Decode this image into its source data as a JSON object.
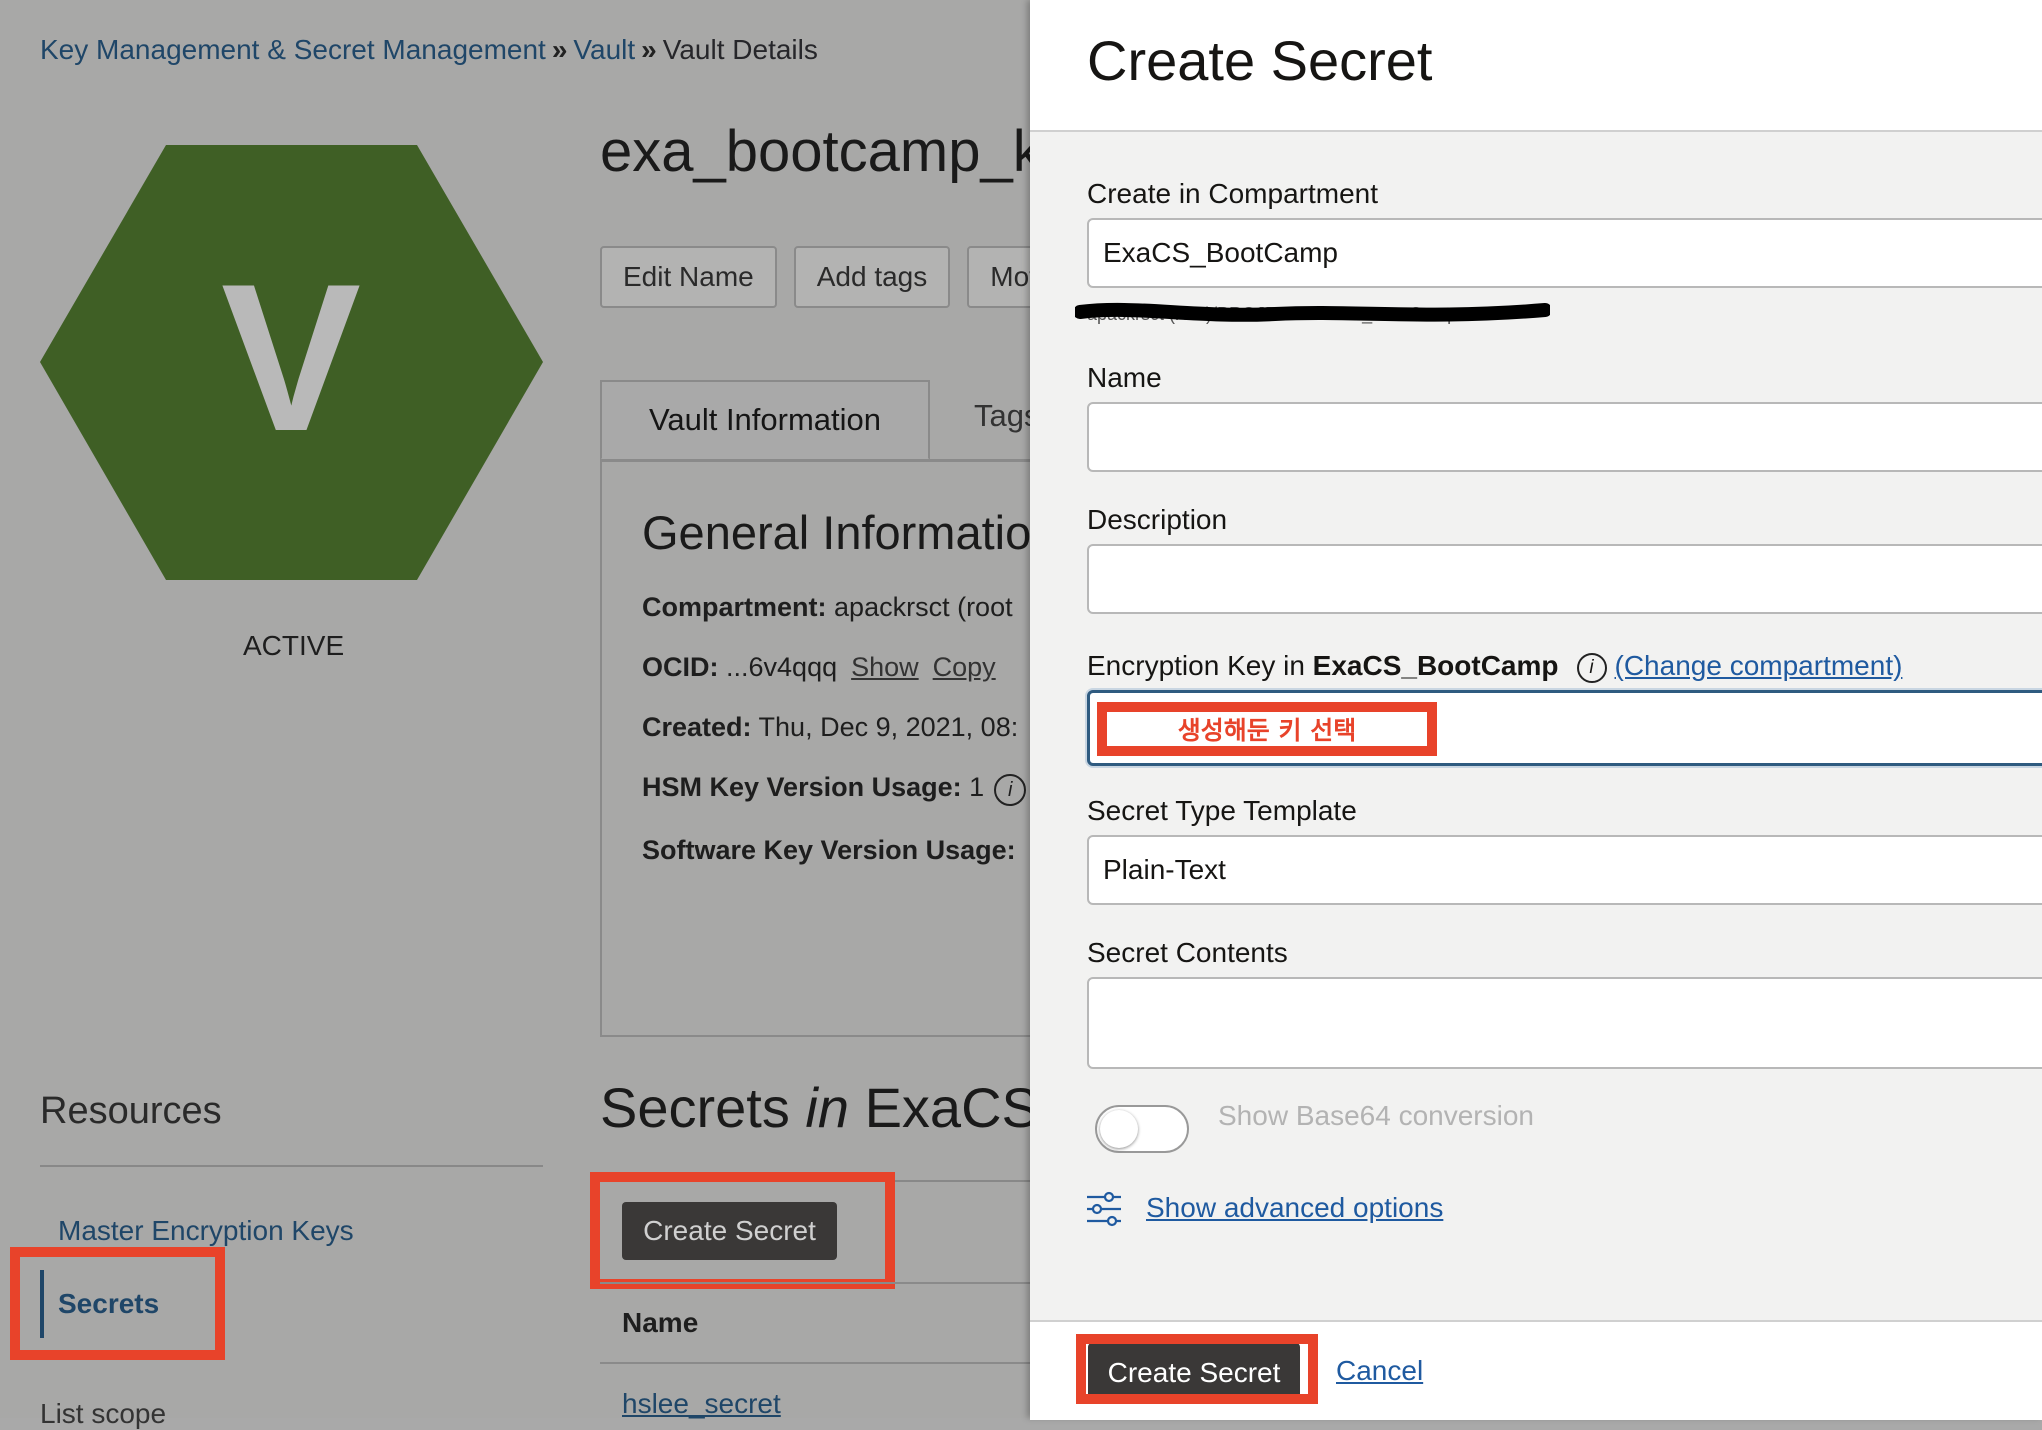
{
  "breadcrumb": {
    "items": [
      "Key Management & Secret Management",
      "Vault",
      "Vault Details"
    ],
    "separator": "»"
  },
  "vault": {
    "avatar_letter": "V",
    "status": "ACTIVE",
    "name": "exa_bootcamp_k",
    "buttons": [
      "Edit Name",
      "Add tags",
      "Mov"
    ],
    "tabs": [
      "Vault Information",
      "Tags"
    ],
    "general_info_title": "General Informatio",
    "info": {
      "compartment_label": "Compartment:",
      "compartment_value": "apackrsct (root",
      "ocid_label": "OCID:",
      "ocid_value": "...6v4qqq",
      "show": "Show",
      "copy": "Copy",
      "created_label": "Created:",
      "created_value": "Thu, Dec 9, 2021, 08:",
      "hsm_label": "HSM Key Version Usage:",
      "hsm_value": "1",
      "software_label": "Software Key Version Usage:"
    }
  },
  "resources": {
    "title": "Resources",
    "items": [
      "Master Encryption Keys",
      "Secrets",
      "List scope"
    ]
  },
  "secrets_section": {
    "title_prefix": "Secrets",
    "title_in": "in",
    "title_suffix": "ExaCS",
    "create_button": "Create Secret",
    "table_header": "Name",
    "rows": [
      "hslee_secret"
    ]
  },
  "panel": {
    "title": "Create Secret",
    "compartment_label": "Create in Compartment",
    "compartment_value": "ExaCS_BootCamp",
    "compartment_path": "apackrsct (root)/PROJECT/ExaCS_BootCamp",
    "name_label": "Name",
    "name_value": "",
    "description_label": "Description",
    "description_value": "",
    "key_label_prefix": "Encryption Key in",
    "key_label_compartment": "ExaCS_BootCamp",
    "change_compartment": "(Change compartment)",
    "key_annotation": "생성해둔 키 선택",
    "type_label": "Secret Type Template",
    "type_value": "Plain-Text",
    "contents_label": "Secret Contents",
    "contents_value": "",
    "toggle_label": "Show Base64 conversion",
    "toggle_on": false,
    "advanced_link": "Show advanced options",
    "create_button": "Create Secret",
    "cancel_link": "Cancel"
  },
  "colors": {
    "highlight": "#e8432a",
    "hexagon": "#3f5f25",
    "link": "#1f5aa0",
    "primary_button": "#3a3837"
  }
}
